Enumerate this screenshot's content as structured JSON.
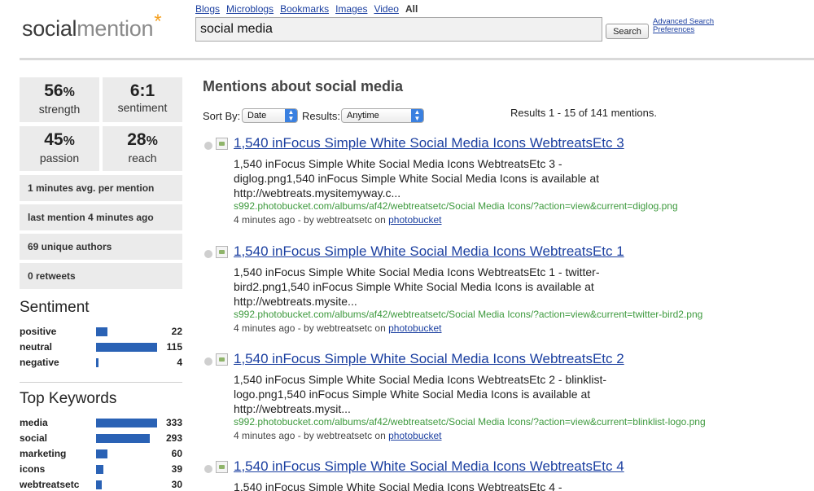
{
  "logo": {
    "part1": "social",
    "part2": "mention",
    "star": "*"
  },
  "nav": [
    "Blogs",
    "Microblogs",
    "Bookmarks",
    "Images",
    "Video"
  ],
  "nav_active": "All",
  "search": {
    "value": "social media",
    "button": "Search",
    "advanced": "Advanced Search",
    "preferences": "Preferences"
  },
  "stats": {
    "strength": {
      "value": "56",
      "unit": "%",
      "label": "strength"
    },
    "sentiment": {
      "value": "6:1",
      "label": "sentiment"
    },
    "passion": {
      "value": "45",
      "unit": "%",
      "label": "passion"
    },
    "reach": {
      "value": "28",
      "unit": "%",
      "label": "reach"
    }
  },
  "info": [
    "1 minutes avg. per mention",
    "last mention 4 minutes ago",
    "69 unique authors",
    "0 retweets"
  ],
  "sentiment": {
    "heading": "Sentiment",
    "items": [
      {
        "label": "positive",
        "count": 22
      },
      {
        "label": "neutral",
        "count": 115
      },
      {
        "label": "negative",
        "count": 4
      }
    ]
  },
  "keywords": {
    "heading": "Top Keywords",
    "items": [
      {
        "label": "media",
        "count": 333
      },
      {
        "label": "social",
        "count": 293
      },
      {
        "label": "marketing",
        "count": 60
      },
      {
        "label": "icons",
        "count": 39
      },
      {
        "label": "webtreatsetc",
        "count": 30
      }
    ]
  },
  "main": {
    "title": "Mentions about social media",
    "sort_label": "Sort By:",
    "sort_value": "Date",
    "results_label": "Results:",
    "results_value": "Anytime",
    "results_count": "Results 1 - 15 of 141 mentions."
  },
  "results": [
    {
      "title": "1,540 inFocus Simple White Social Media Icons WebtreatsEtc 3",
      "snippet": "1,540 inFocus Simple White Social Media Icons WebtreatsEtc 3 - diglog.png1,540 inFocus Simple White Social Media Icons is available at http://webtreats.mysitemyway.c...",
      "url": "s992.photobucket.com/albums/af42/webtreatsetc/Social Media Icons/?action=view&current=diglog.png",
      "meta": "4 minutes ago - by webtreatsetc on",
      "source": "photobucket"
    },
    {
      "title": "1,540 inFocus Simple White Social Media Icons WebtreatsEtc 1",
      "snippet": "1,540 inFocus Simple White Social Media Icons WebtreatsEtc 1 - twitter-bird2.png1,540 inFocus Simple White Social Media Icons is available at http://webtreats.mysite...",
      "url": "s992.photobucket.com/albums/af42/webtreatsetc/Social Media Icons/?action=view&current=twitter-bird2.png",
      "meta": "4 minutes ago - by webtreatsetc on",
      "source": "photobucket"
    },
    {
      "title": "1,540 inFocus Simple White Social Media Icons WebtreatsEtc 2",
      "snippet": "1,540 inFocus Simple White Social Media Icons WebtreatsEtc 2 - blinklist-logo.png1,540 inFocus Simple White Social Media Icons is available at http://webtreats.mysit...",
      "url": "s992.photobucket.com/albums/af42/webtreatsetc/Social Media Icons/?action=view&current=blinklist-logo.png",
      "meta": "4 minutes ago - by webtreatsetc on",
      "source": "photobucket"
    },
    {
      "title": "1,540 inFocus Simple White Social Media Icons WebtreatsEtc 4",
      "snippet": "1,540 inFocus Simple White Social Media Icons WebtreatsEtc 4 -",
      "url": "",
      "meta": "",
      "source": ""
    }
  ],
  "colors": {
    "bar": "#2a62b5",
    "link": "#1b3fa0",
    "url": "#3e9a3e",
    "logo_star": "#f5a020"
  }
}
